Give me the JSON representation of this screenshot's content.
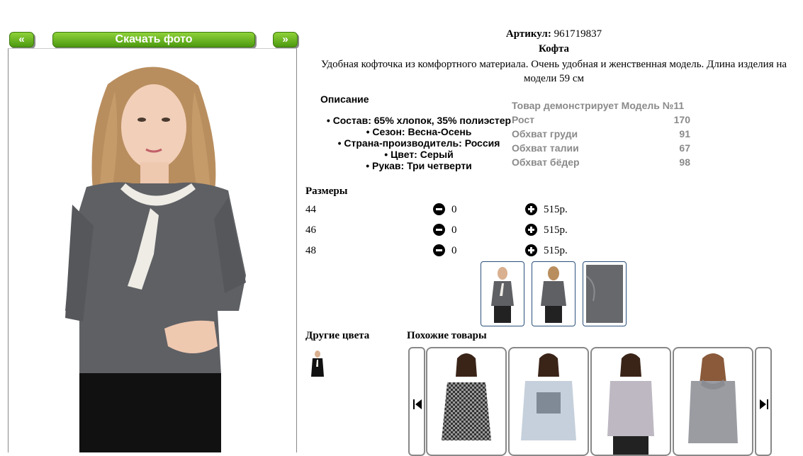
{
  "nav": {
    "prev_label": "«",
    "next_label": "»",
    "download_label": "Скачать фото"
  },
  "product": {
    "article_label": "Артикул:",
    "article_value": "961719837",
    "title": "Кофта",
    "description": "Удобная кофточка из комфортного материала. Очень удобная и женственная модель. Длина изделия на модели 59 см"
  },
  "details": {
    "heading": "Описание",
    "items": [
      "Состав: 65% хлопок, 35% полиэстер",
      "Сезон: Весна-Осень",
      "Страна-производитель: Россия",
      "Цвет: Серый",
      "Рукав: Три четверти"
    ]
  },
  "model": {
    "heading": "Товар демонстрирует Модель №11",
    "rows": [
      {
        "label": "Рост",
        "value": "170"
      },
      {
        "label": "Обхват груди",
        "value": "91"
      },
      {
        "label": "Обхват талии",
        "value": "67"
      },
      {
        "label": "Обхват бёдер",
        "value": "98"
      }
    ]
  },
  "sizes": {
    "heading": "Размеры",
    "rows": [
      {
        "size": "44",
        "qty": "0",
        "price": "515р."
      },
      {
        "size": "46",
        "qty": "0",
        "price": "515р."
      },
      {
        "size": "48",
        "qty": "0",
        "price": "515р."
      }
    ]
  },
  "other_colors": {
    "heading": "Другие цвета"
  },
  "similar": {
    "heading": "Похожие товары"
  },
  "icons": {
    "minus": "minus-circle-icon",
    "plus": "plus-circle-icon",
    "prev": "skip-previous-icon",
    "next": "skip-next-icon"
  },
  "colors": {
    "button_green": "#5aaa16",
    "thumb_border": "#2a4f7a",
    "model_text": "#8a8a8a"
  }
}
